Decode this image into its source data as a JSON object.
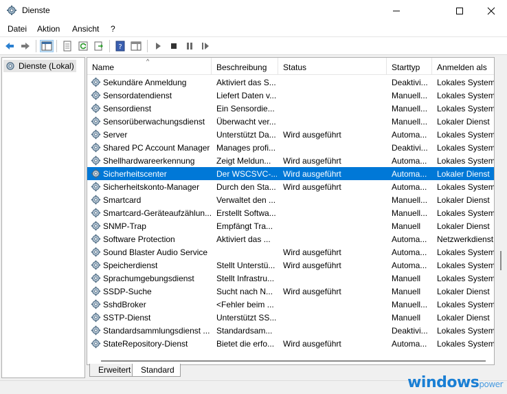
{
  "window": {
    "title": "Dienste"
  },
  "menu": [
    "Datei",
    "Aktion",
    "Ansicht",
    "?"
  ],
  "tree": {
    "root_label": "Dienste (Lokal)"
  },
  "columns": [
    "Name",
    "Beschreibung",
    "Status",
    "Starttyp",
    "Anmelden als"
  ],
  "services": [
    {
      "name": "Sekundäre Anmeldung",
      "desc": "Aktiviert das S...",
      "status": "",
      "start": "Deaktivi...",
      "logon": "Lokales System"
    },
    {
      "name": "Sensordatendienst",
      "desc": "Liefert Daten v...",
      "status": "",
      "start": "Manuell...",
      "logon": "Lokales System"
    },
    {
      "name": "Sensordienst",
      "desc": "Ein Sensordie...",
      "status": "",
      "start": "Manuell...",
      "logon": "Lokales System"
    },
    {
      "name": "Sensorüberwachungsdienst",
      "desc": "Überwacht ver...",
      "status": "",
      "start": "Manuell...",
      "logon": "Lokaler Dienst"
    },
    {
      "name": "Server",
      "desc": "Unterstützt Da...",
      "status": "Wird ausgeführt",
      "start": "Automa...",
      "logon": "Lokales System"
    },
    {
      "name": "Shared PC Account Manager",
      "desc": "Manages profi...",
      "status": "",
      "start": "Deaktivi...",
      "logon": "Lokales System"
    },
    {
      "name": "Shellhardwareerkennung",
      "desc": "Zeigt Meldun...",
      "status": "Wird ausgeführt",
      "start": "Automa...",
      "logon": "Lokales System"
    },
    {
      "name": "Sicherheitscenter",
      "desc": "Der WSCSVC-...",
      "status": "Wird ausgeführt",
      "start": "Automa...",
      "logon": "Lokaler Dienst",
      "selected": true
    },
    {
      "name": "Sicherheitskonto-Manager",
      "desc": "Durch den Sta...",
      "status": "Wird ausgeführt",
      "start": "Automa...",
      "logon": "Lokales System"
    },
    {
      "name": "Smartcard",
      "desc": "Verwaltet den ...",
      "status": "",
      "start": "Manuell...",
      "logon": "Lokaler Dienst"
    },
    {
      "name": "Smartcard-Geräteaufzählun...",
      "desc": "Erstellt Softwa...",
      "status": "",
      "start": "Manuell...",
      "logon": "Lokales System"
    },
    {
      "name": "SNMP-Trap",
      "desc": "Empfängt Tra...",
      "status": "",
      "start": "Manuell",
      "logon": "Lokaler Dienst"
    },
    {
      "name": "Software Protection",
      "desc": "Aktiviert das ...",
      "status": "",
      "start": "Automa...",
      "logon": "Netzwerkdienst"
    },
    {
      "name": "Sound Blaster Audio Service",
      "desc": "",
      "status": "Wird ausgeführt",
      "start": "Automa...",
      "logon": "Lokales System"
    },
    {
      "name": "Speicherdienst",
      "desc": "Stellt Unterstü...",
      "status": "Wird ausgeführt",
      "start": "Automa...",
      "logon": "Lokales System"
    },
    {
      "name": "Sprachumgebungsdienst",
      "desc": "Stellt Infrastru...",
      "status": "",
      "start": "Manuell",
      "logon": "Lokales System"
    },
    {
      "name": "SSDP-Suche",
      "desc": "Sucht nach N...",
      "status": "Wird ausgeführt",
      "start": "Manuell",
      "logon": "Lokaler Dienst"
    },
    {
      "name": "SshdBroker",
      "desc": "<Fehler beim ...",
      "status": "",
      "start": "Manuell...",
      "logon": "Lokales System"
    },
    {
      "name": "SSTP-Dienst",
      "desc": "Unterstützt SS...",
      "status": "",
      "start": "Manuell",
      "logon": "Lokaler Dienst"
    },
    {
      "name": "Standardsammlungsdienst ...",
      "desc": "Standardsam...",
      "status": "",
      "start": "Deaktivi...",
      "logon": "Lokales System"
    },
    {
      "name": "StateRepository-Dienst",
      "desc": "Bietet die erfo...",
      "status": "Wird ausgeführt",
      "start": "Automa...",
      "logon": "Lokales System"
    }
  ],
  "tabs": [
    "Erweitert",
    "Standard"
  ],
  "watermark": {
    "main": "windows",
    "suffix": "power"
  },
  "colors": {
    "selection": "#0078d7",
    "accent": "#1a7fd4"
  }
}
